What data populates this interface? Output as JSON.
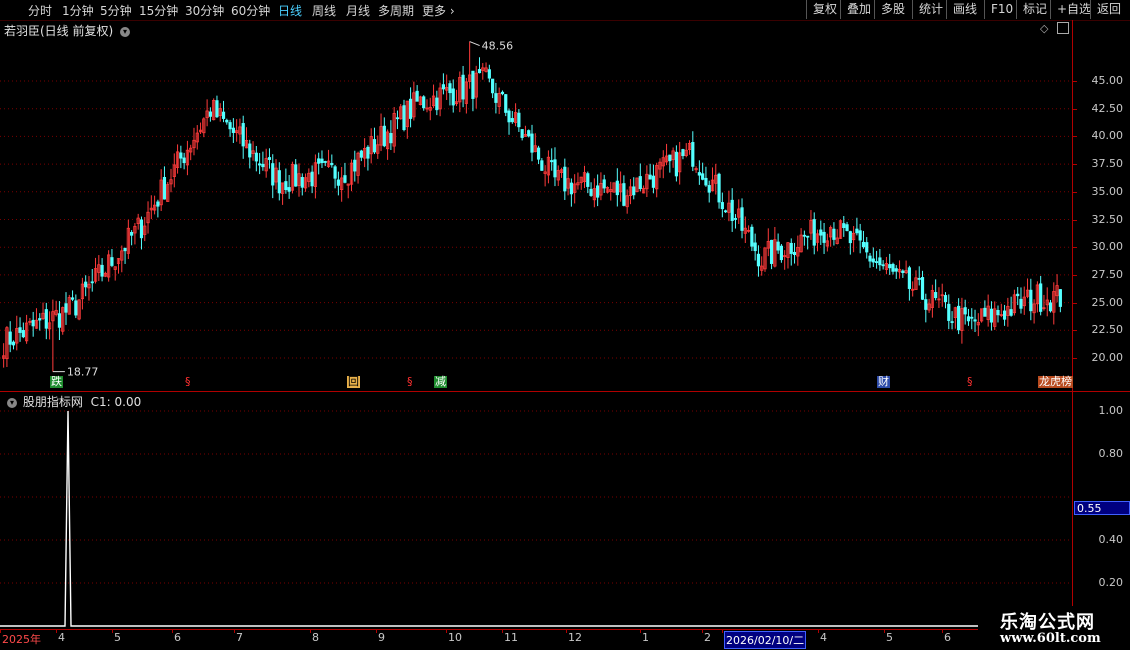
{
  "toolbar": {
    "periods": [
      "分时",
      "1分钟",
      "5分钟",
      "15分钟",
      "30分钟",
      "60分钟",
      "日线",
      "周线",
      "月线",
      "多周期",
      "更多"
    ],
    "active_period": "日线",
    "right_buttons": [
      "复权",
      "叠加",
      "多股",
      "统计",
      "画线",
      "F10",
      "标记",
      "+自选",
      "返回"
    ]
  },
  "main_panel": {
    "title": "若羽臣(日线 前复权)",
    "high_label": "48.56",
    "low_label": "18.77",
    "markers": [
      {
        "text": "跌",
        "color": "#ffffff",
        "bg": "#1e8c2e"
      },
      {
        "text": "§",
        "color": "#ff3030",
        "bg": ""
      },
      {
        "text": "回",
        "color": "#000000",
        "bg": "#e8b04a"
      },
      {
        "text": "§",
        "color": "#ff3030",
        "bg": ""
      },
      {
        "text": "减",
        "color": "#ffffff",
        "bg": "#1e8c2e"
      },
      {
        "text": "财",
        "color": "#ffffff",
        "bg": "#2c4aa8"
      },
      {
        "text": "§",
        "color": "#ff3030",
        "bg": ""
      },
      {
        "text": "龙虎榜",
        "color": "#ffffff",
        "bg": "#b84a1e"
      }
    ],
    "y_ticks": [
      "45.00",
      "42.50",
      "40.00",
      "37.50",
      "35.00",
      "32.50",
      "30.00",
      "27.50",
      "25.00",
      "22.50",
      "20.00"
    ]
  },
  "indicator_panel": {
    "title": "股朋指标网",
    "value_label": "C1: 0.00",
    "y_ticks": [
      "1.00",
      "0.80",
      "0.40",
      "0.20"
    ],
    "highlight_value": "0.55"
  },
  "x_axis": {
    "labels": [
      "2025年",
      "4",
      "5",
      "6",
      "7",
      "8",
      "9",
      "10",
      "11",
      "12",
      "1",
      "2",
      "2026/02/10/二",
      "4",
      "5",
      "6"
    ]
  },
  "watermark": {
    "line1": "乐淘公式网",
    "line2": "www.60lt.com"
  },
  "colors": {
    "up": "#ff3b3b",
    "down": "#54ffff",
    "grid": "#7a0000",
    "axis": "#b00000"
  },
  "chart_data": {
    "type": "candlestick",
    "title": "若羽臣(日线 前复权)",
    "y_range": [
      18,
      50
    ],
    "highest": 48.56,
    "lowest": 18.77,
    "approx_close_path": [
      {
        "month": "2025-03",
        "price": 21.5
      },
      {
        "month": "2025-04",
        "price": 24.5
      },
      {
        "month": "2025-05",
        "price": 32
      },
      {
        "month": "2025-06",
        "price": 42.5
      },
      {
        "month": "2025-07",
        "price": 36
      },
      {
        "month": "2025-08",
        "price": 37
      },
      {
        "month": "2025-09",
        "price": 43
      },
      {
        "month": "2025-10",
        "price": 45
      },
      {
        "month": "2025-11",
        "price": 36
      },
      {
        "month": "2025-12",
        "price": 35
      },
      {
        "month": "2026-01",
        "price": 38.5
      },
      {
        "month": "2026-02",
        "price": 29
      },
      {
        "month": "2026-03",
        "price": 32
      },
      {
        "month": "2026-04",
        "price": 27
      },
      {
        "month": "2026-05",
        "price": 23
      },
      {
        "month": "2026-06",
        "price": 25.5
      }
    ],
    "indicator": {
      "name": "股朋指标网",
      "series": "C1",
      "current": 0.0,
      "spike_value": 1.0,
      "y_range": [
        0,
        1.05
      ]
    }
  }
}
